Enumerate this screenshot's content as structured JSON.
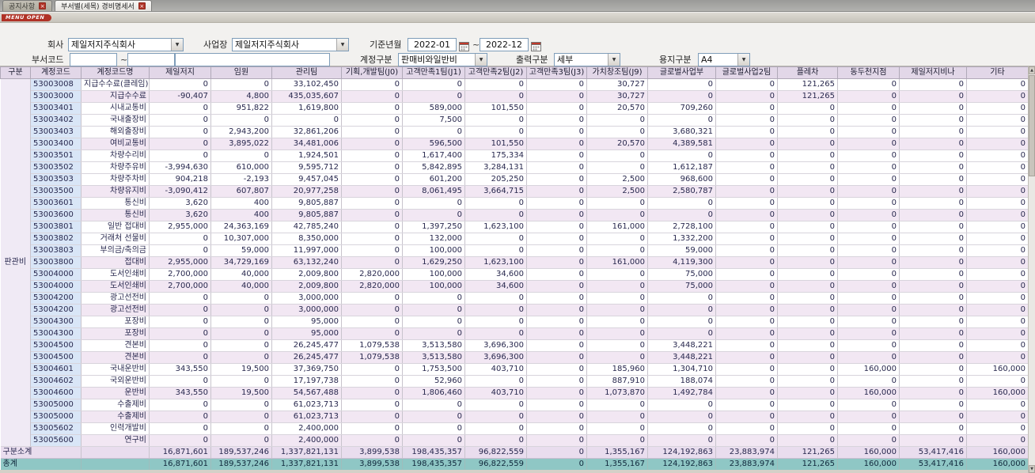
{
  "tabs": {
    "notice": {
      "label": "공지사항"
    },
    "report": {
      "label": "부서별(세목) 경비명세서"
    }
  },
  "menu_badge": "MENU OPEN",
  "filters": {
    "company": {
      "label": "회사",
      "value": "제일저지주식회사"
    },
    "site": {
      "label": "사업장",
      "value": "제일저지주식회사"
    },
    "period": {
      "label": "기준년월",
      "from": "2022-01",
      "to": "2022-12",
      "separator": "~"
    },
    "dept_code": {
      "label": "부서코드",
      "from": "",
      "to": "",
      "name": "",
      "separator": "~"
    },
    "account_type": {
      "label": "계정구분",
      "value": "판매비와일반비"
    },
    "output_type": {
      "label": "출력구분",
      "value": "세부"
    },
    "paper_type": {
      "label": "용지구분",
      "value": "A4"
    }
  },
  "colors": {
    "accent-red": "#B03226",
    "header-bg": "#E2D7E8",
    "subtotal-bg": "#F2E7F3",
    "total-bg": "#8FC7C5",
    "code-bg": "#D9E6F7",
    "code-fg": "#2244CC"
  },
  "table": {
    "columns": [
      "구분",
      "계정코드",
      "계정코드명",
      "제일저지",
      "임원",
      "관리팀",
      "기획,개발팀(J0)",
      "고객만족1팀(J1)",
      "고객만족2팀(J2)",
      "고객만족3팀(J3)",
      "가치창조팀(J9)",
      "글로벌사업부",
      "글로벌사업2팀",
      "플레차",
      "동두천지점",
      "제일저지비나",
      "기타"
    ],
    "group_label": "판관비",
    "rows": [
      {
        "code": "53003008",
        "name": "지급수수료(클레임)",
        "type": "detail",
        "values": [
          "0",
          "0",
          "33,102,450",
          "0",
          "0",
          "0",
          "0",
          "30,727",
          "0",
          "0",
          "121,265",
          "0",
          "0",
          "0"
        ]
      },
      {
        "code": "53003000",
        "name": "지급수수료",
        "type": "subtotal",
        "values": [
          "-90,407",
          "4,800",
          "435,035,607",
          "0",
          "0",
          "0",
          "0",
          "30,727",
          "0",
          "0",
          "121,265",
          "0",
          "0",
          "0"
        ]
      },
      {
        "code": "53003401",
        "name": "시내교통비",
        "type": "detail",
        "values": [
          "0",
          "951,822",
          "1,619,800",
          "0",
          "589,000",
          "101,550",
          "0",
          "20,570",
          "709,260",
          "0",
          "0",
          "0",
          "0",
          "0"
        ]
      },
      {
        "code": "53003402",
        "name": "국내출장비",
        "type": "detail",
        "values": [
          "0",
          "0",
          "0",
          "0",
          "7,500",
          "0",
          "0",
          "0",
          "0",
          "0",
          "0",
          "0",
          "0",
          "0"
        ]
      },
      {
        "code": "53003403",
        "name": "해외출장비",
        "type": "detail",
        "values": [
          "0",
          "2,943,200",
          "32,861,206",
          "0",
          "0",
          "0",
          "0",
          "0",
          "3,680,321",
          "0",
          "0",
          "0",
          "0",
          "0"
        ]
      },
      {
        "code": "53003400",
        "name": "여비교통비",
        "type": "subtotal",
        "values": [
          "0",
          "3,895,022",
          "34,481,006",
          "0",
          "596,500",
          "101,550",
          "0",
          "20,570",
          "4,389,581",
          "0",
          "0",
          "0",
          "0",
          "0"
        ]
      },
      {
        "code": "53003501",
        "name": "차량수리비",
        "type": "detail",
        "values": [
          "0",
          "0",
          "1,924,501",
          "0",
          "1,617,400",
          "175,334",
          "0",
          "0",
          "0",
          "0",
          "0",
          "0",
          "0",
          "0"
        ]
      },
      {
        "code": "53003502",
        "name": "차량주유비",
        "type": "detail",
        "values": [
          "-3,994,630",
          "610,000",
          "9,595,712",
          "0",
          "5,842,895",
          "3,284,131",
          "0",
          "0",
          "1,612,187",
          "0",
          "0",
          "0",
          "0",
          "0"
        ]
      },
      {
        "code": "53003503",
        "name": "차량주차비",
        "type": "detail",
        "values": [
          "904,218",
          "-2,193",
          "9,457,045",
          "0",
          "601,200",
          "205,250",
          "0",
          "2,500",
          "968,600",
          "0",
          "0",
          "0",
          "0",
          "0"
        ]
      },
      {
        "code": "53003500",
        "name": "차량유지비",
        "type": "subtotal",
        "values": [
          "-3,090,412",
          "607,807",
          "20,977,258",
          "0",
          "8,061,495",
          "3,664,715",
          "0",
          "2,500",
          "2,580,787",
          "0",
          "0",
          "0",
          "0",
          "0"
        ]
      },
      {
        "code": "53003601",
        "name": "통신비",
        "type": "detail",
        "values": [
          "3,620",
          "400",
          "9,805,887",
          "0",
          "0",
          "0",
          "0",
          "0",
          "0",
          "0",
          "0",
          "0",
          "0",
          "0"
        ]
      },
      {
        "code": "53003600",
        "name": "통신비",
        "type": "subtotal",
        "values": [
          "3,620",
          "400",
          "9,805,887",
          "0",
          "0",
          "0",
          "0",
          "0",
          "0",
          "0",
          "0",
          "0",
          "0",
          "0"
        ]
      },
      {
        "code": "53003801",
        "name": "일반 접대비",
        "type": "detail",
        "values": [
          "2,955,000",
          "24,363,169",
          "42,785,240",
          "0",
          "1,397,250",
          "1,623,100",
          "0",
          "161,000",
          "2,728,100",
          "0",
          "0",
          "0",
          "0",
          "0"
        ]
      },
      {
        "code": "53003802",
        "name": "거래처 선물비",
        "type": "detail",
        "values": [
          "0",
          "10,307,000",
          "8,350,000",
          "0",
          "132,000",
          "0",
          "0",
          "0",
          "1,332,200",
          "0",
          "0",
          "0",
          "0",
          "0"
        ]
      },
      {
        "code": "53003803",
        "name": "부의금/축의금",
        "type": "detail",
        "values": [
          "0",
          "59,000",
          "11,997,000",
          "0",
          "100,000",
          "0",
          "0",
          "0",
          "59,000",
          "0",
          "0",
          "0",
          "0",
          "0"
        ]
      },
      {
        "code": "53003800",
        "name": "접대비",
        "type": "subtotal",
        "values": [
          "2,955,000",
          "34,729,169",
          "63,132,240",
          "0",
          "1,629,250",
          "1,623,100",
          "0",
          "161,000",
          "4,119,300",
          "0",
          "0",
          "0",
          "0",
          "0"
        ]
      },
      {
        "code": "53004000",
        "name": "도서인쇄비",
        "type": "detail",
        "values": [
          "2,700,000",
          "40,000",
          "2,009,800",
          "2,820,000",
          "100,000",
          "34,600",
          "0",
          "0",
          "75,000",
          "0",
          "0",
          "0",
          "0",
          "0"
        ]
      },
      {
        "code": "53004000",
        "name": "도서인쇄비",
        "type": "subtotal",
        "values": [
          "2,700,000",
          "40,000",
          "2,009,800",
          "2,820,000",
          "100,000",
          "34,600",
          "0",
          "0",
          "75,000",
          "0",
          "0",
          "0",
          "0",
          "0"
        ]
      },
      {
        "code": "53004200",
        "name": "광고선전비",
        "type": "detail",
        "values": [
          "0",
          "0",
          "3,000,000",
          "0",
          "0",
          "0",
          "0",
          "0",
          "0",
          "0",
          "0",
          "0",
          "0",
          "0"
        ]
      },
      {
        "code": "53004200",
        "name": "광고선전비",
        "type": "subtotal",
        "values": [
          "0",
          "0",
          "3,000,000",
          "0",
          "0",
          "0",
          "0",
          "0",
          "0",
          "0",
          "0",
          "0",
          "0",
          "0"
        ]
      },
      {
        "code": "53004300",
        "name": "포장비",
        "type": "detail",
        "values": [
          "0",
          "0",
          "95,000",
          "0",
          "0",
          "0",
          "0",
          "0",
          "0",
          "0",
          "0",
          "0",
          "0",
          "0"
        ]
      },
      {
        "code": "53004300",
        "name": "포장비",
        "type": "subtotal",
        "values": [
          "0",
          "0",
          "95,000",
          "0",
          "0",
          "0",
          "0",
          "0",
          "0",
          "0",
          "0",
          "0",
          "0",
          "0"
        ]
      },
      {
        "code": "53004500",
        "name": "견본비",
        "type": "detail",
        "values": [
          "0",
          "0",
          "26,245,477",
          "1,079,538",
          "3,513,580",
          "3,696,300",
          "0",
          "0",
          "3,448,221",
          "0",
          "0",
          "0",
          "0",
          "0"
        ]
      },
      {
        "code": "53004500",
        "name": "견본비",
        "type": "subtotal",
        "values": [
          "0",
          "0",
          "26,245,477",
          "1,079,538",
          "3,513,580",
          "3,696,300",
          "0",
          "0",
          "3,448,221",
          "0",
          "0",
          "0",
          "0",
          "0"
        ]
      },
      {
        "code": "53004601",
        "name": "국내운반비",
        "type": "detail",
        "values": [
          "343,550",
          "19,500",
          "37,369,750",
          "0",
          "1,753,500",
          "403,710",
          "0",
          "185,960",
          "1,304,710",
          "0",
          "0",
          "160,000",
          "0",
          "160,000"
        ]
      },
      {
        "code": "53004602",
        "name": "국외운반비",
        "type": "detail",
        "values": [
          "0",
          "0",
          "17,197,738",
          "0",
          "52,960",
          "0",
          "0",
          "887,910",
          "188,074",
          "0",
          "0",
          "0",
          "0",
          "0"
        ]
      },
      {
        "code": "53004600",
        "name": "운반비",
        "type": "subtotal",
        "values": [
          "343,550",
          "19,500",
          "54,567,488",
          "0",
          "1,806,460",
          "403,710",
          "0",
          "1,073,870",
          "1,492,784",
          "0",
          "0",
          "160,000",
          "0",
          "160,000"
        ]
      },
      {
        "code": "53005000",
        "name": "수출제비",
        "type": "detail",
        "values": [
          "0",
          "0",
          "61,023,713",
          "0",
          "0",
          "0",
          "0",
          "0",
          "0",
          "0",
          "0",
          "0",
          "0",
          "0"
        ]
      },
      {
        "code": "53005000",
        "name": "수출제비",
        "type": "subtotal",
        "values": [
          "0",
          "0",
          "61,023,713",
          "0",
          "0",
          "0",
          "0",
          "0",
          "0",
          "0",
          "0",
          "0",
          "0",
          "0"
        ]
      },
      {
        "code": "53005602",
        "name": "인력개발비",
        "type": "detail",
        "values": [
          "0",
          "0",
          "2,400,000",
          "0",
          "0",
          "0",
          "0",
          "0",
          "0",
          "0",
          "0",
          "0",
          "0",
          "0"
        ]
      },
      {
        "code": "53005600",
        "name": "연구비",
        "type": "subtotal",
        "values": [
          "0",
          "0",
          "2,400,000",
          "0",
          "0",
          "0",
          "0",
          "0",
          "0",
          "0",
          "0",
          "0",
          "0",
          "0"
        ]
      }
    ],
    "summary_rows": [
      {
        "label": "구분소계",
        "type": "section-total",
        "values": [
          "16,871,601",
          "189,537,246",
          "1,337,821,131",
          "3,899,538",
          "198,435,357",
          "96,822,559",
          "0",
          "1,355,167",
          "124,192,863",
          "23,883,974",
          "121,265",
          "160,000",
          "53,417,416",
          "160,000"
        ]
      },
      {
        "label": "총계",
        "type": "grand-total",
        "values": [
          "16,871,601",
          "189,537,246",
          "1,337,821,131",
          "3,899,538",
          "198,435,357",
          "96,822,559",
          "0",
          "1,355,167",
          "124,192,863",
          "23,883,974",
          "121,265",
          "160,000",
          "53,417,416",
          "160,000"
        ]
      }
    ]
  }
}
